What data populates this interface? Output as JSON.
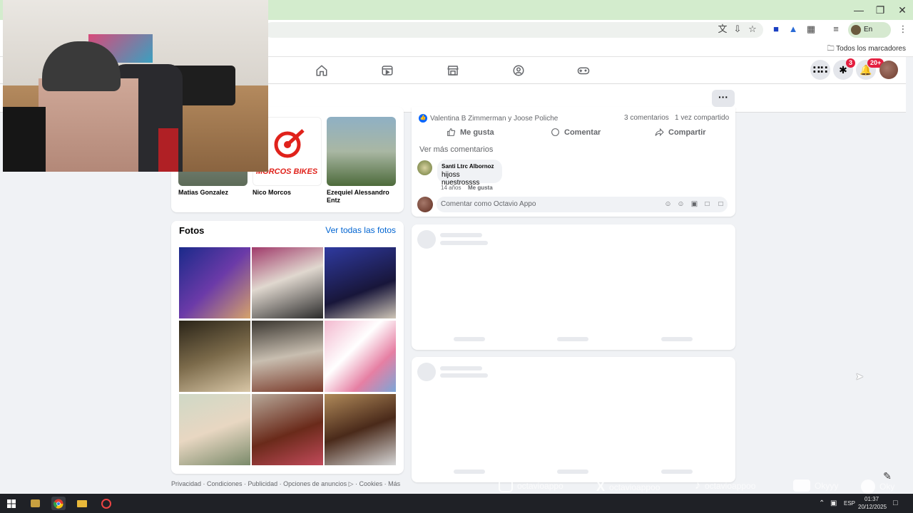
{
  "browser": {
    "profile_status": "En pausa",
    "bookmarks_all": "Todos los marcadores"
  },
  "nav": {
    "messenger_badge": "3",
    "notifications_badge": "20+"
  },
  "friends": [
    {
      "name": "Matias Gonzalez"
    },
    {
      "name": "Nico Morcos"
    },
    {
      "name": "Ezequiel Alessandro Entz"
    }
  ],
  "friend_photo_text": "MORCOS BIKES",
  "photos": {
    "title": "Fotos",
    "see_all": "Ver todas las fotos"
  },
  "footer": {
    "links": "Privacidad · Condiciones · Publicidad · Opciones de anuncios ▷ · Cookies · Más"
  },
  "post": {
    "reactors": "Valentina B Zimmerman y Joose Poliche",
    "comments_count": "3 comentarios",
    "shares_count": "1 vez compartido",
    "like_label": "Me gusta",
    "comment_label": "Comentar",
    "share_label": "Compartir",
    "more_comments": "Ver más comentarios",
    "comment": {
      "author": "Santi Ltrc Albornoz",
      "text": "hijoss nuestrossss",
      "age": "14 años",
      "like": "Me gusta"
    },
    "comment_placeholder": "Comentar como Octavio Appo"
  },
  "overlay_socials": [
    {
      "icon": "instagram-icon",
      "handle": "octavioappo"
    },
    {
      "icon": "x-icon",
      "handle": "octavioappoo"
    },
    {
      "icon": "tiktok-icon",
      "handle": "octavioappoo"
    },
    {
      "icon": "youtube-icon",
      "handle": "Okyyy"
    },
    {
      "icon": "spotify-icon",
      "handle": "Oky"
    }
  ],
  "taskbar": {
    "lang": "ESP",
    "time": "01:37",
    "date": "20/12/2025"
  },
  "colors": {
    "fb_blue": "#0866ff",
    "link_blue": "#0064d1",
    "badge_red": "#e41e3f",
    "titlebar_green": "#d3eccd"
  }
}
